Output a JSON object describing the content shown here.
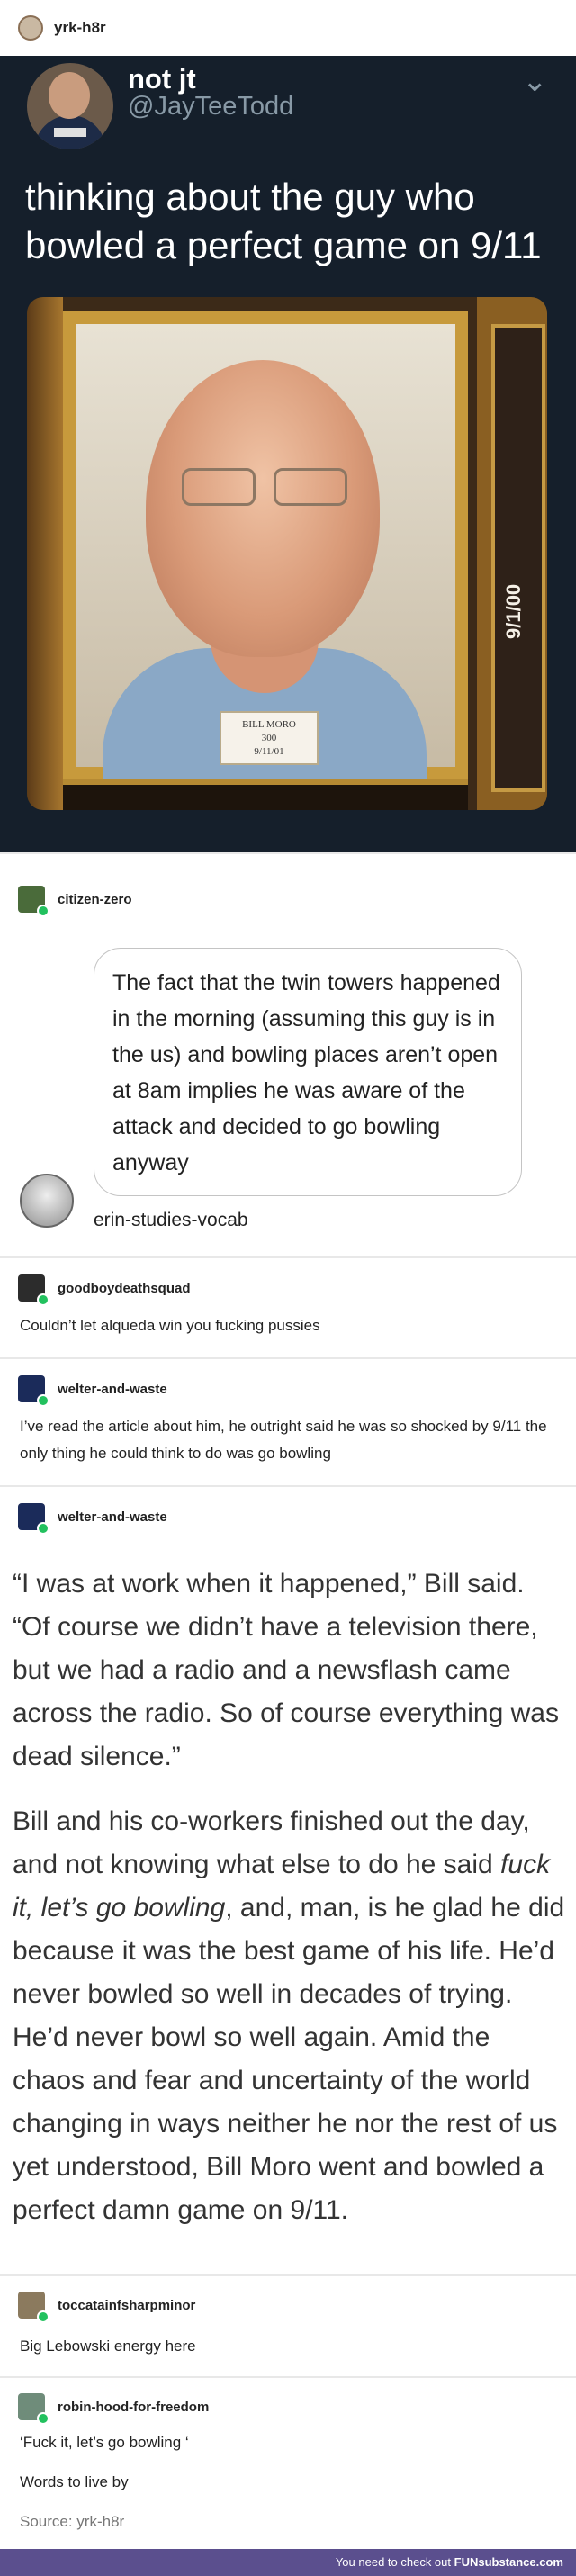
{
  "header": {
    "username": "yrk-h8r"
  },
  "tweet": {
    "display_name": "not jt",
    "handle": "@JayTeeTodd",
    "text": "thinking about the guy who bowled a perfect game on 9/11",
    "photo_plaque": {
      "name": "BILL MORO",
      "score": "300",
      "date": "9/11/01"
    },
    "side_plaque": "9/1/00"
  },
  "posts": [
    {
      "user": "citizen-zero"
    },
    {
      "bubble_text": "The fact that the twin towers happened in the morning (assuming this guy is in the us) and bowling places aren’t open at 8am implies he was aware of the attack and decided to go bowling anyway",
      "bubble_user": "erin-studies-vocab"
    },
    {
      "user": "goodboydeathsquad",
      "text": "Couldn’t let alqueda win you fucking pussies"
    },
    {
      "user": "welter-and-waste",
      "text": "I’ve read the article about him, he outright said he was so shocked by 9/11 the only thing he could think to do was go bowling"
    },
    {
      "user": "welter-and-waste",
      "p1": "“I was at work when it happened,” Bill said. “Of course we didn’t have a television there, but we had a radio and a newsflash came across the radio. So of course everything was dead silence.”",
      "p2_a": "Bill and his co-workers finished out the day, and not knowing what else to do he said ",
      "p2_em": "fuck it, let’s go bowling",
      "p2_b": ", and, man, is he glad he did because it was the best game of his life. He’d never bowled so well in decades of trying. He’d never bowl so well again. Amid the chaos and fear and uncertainty of the world changing in ways neither he nor the rest of us yet understood, Bill Moro went and bowled a perfect damn game on 9/11."
    },
    {
      "user": "toccatainfsharpminor",
      "text": "Big Lebowski energy here"
    },
    {
      "user": "robin-hood-for-freedom",
      "line1": "‘Fuck it, let’s go bowling ‘",
      "line2": "Words to live by",
      "source": "Source: yrk-h8r"
    }
  ],
  "footer": {
    "text": "You need to check out ",
    "brand": "FUNsubstance.com"
  }
}
